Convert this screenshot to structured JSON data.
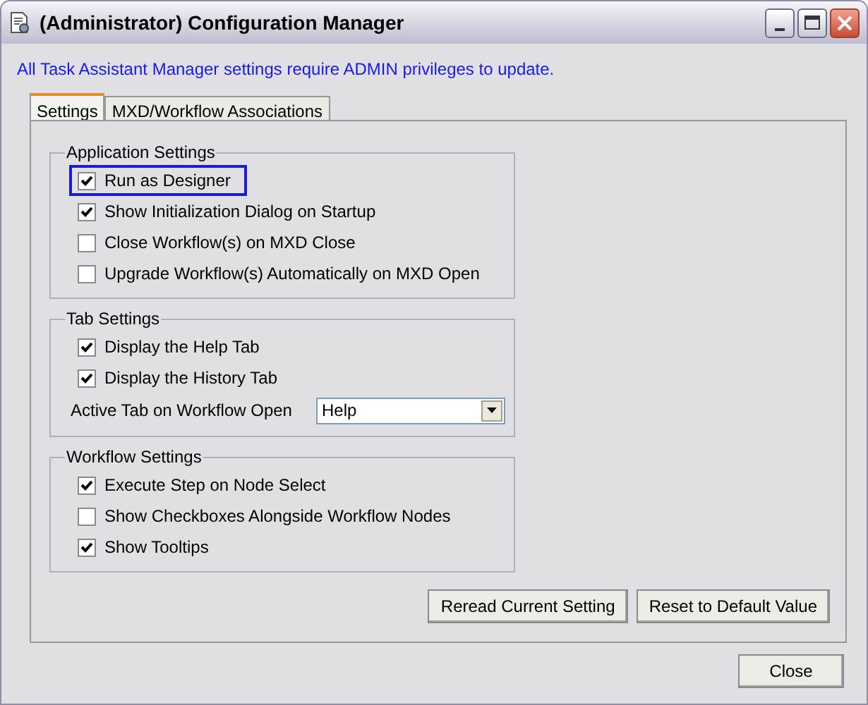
{
  "window": {
    "title": "(Administrator) Configuration Manager"
  },
  "notice": "All Task Assistant Manager settings require ADMIN privileges to update.",
  "tabs": [
    {
      "label": "Settings",
      "selected": true
    },
    {
      "label": "MXD/Workflow Associations",
      "selected": false
    }
  ],
  "groups": [
    {
      "title": "Application Settings",
      "items": [
        {
          "kind": "checkbox",
          "label": "Run as Designer",
          "checked": true,
          "focused": true
        },
        {
          "kind": "checkbox",
          "label": "Show Initialization Dialog on Startup",
          "checked": true,
          "focused": false
        },
        {
          "kind": "checkbox",
          "label": "Close Workflow(s) on MXD Close",
          "checked": false,
          "focused": false
        },
        {
          "kind": "checkbox",
          "label": "Upgrade Workflow(s) Automatically on MXD Open",
          "checked": false,
          "focused": false
        }
      ]
    },
    {
      "title": "Tab Settings",
      "items": [
        {
          "kind": "checkbox",
          "label": "Display the Help Tab",
          "checked": true,
          "focused": false
        },
        {
          "kind": "checkbox",
          "label": "Display the History Tab",
          "checked": true,
          "focused": false
        },
        {
          "kind": "dropdown",
          "label": "Active Tab on Workflow Open",
          "value": "Help"
        }
      ]
    },
    {
      "title": "Workflow Settings",
      "items": [
        {
          "kind": "checkbox",
          "label": "Execute Step on Node Select",
          "checked": true,
          "focused": false
        },
        {
          "kind": "checkbox",
          "label": "Show Checkboxes Alongside Workflow Nodes",
          "checked": false,
          "focused": false
        },
        {
          "kind": "checkbox",
          "label": "Show Tooltips",
          "checked": true,
          "focused": false
        }
      ]
    }
  ],
  "panel_buttons": [
    "Reread  Current Setting",
    "Reset to Default Value"
  ],
  "close_button": "Close"
}
